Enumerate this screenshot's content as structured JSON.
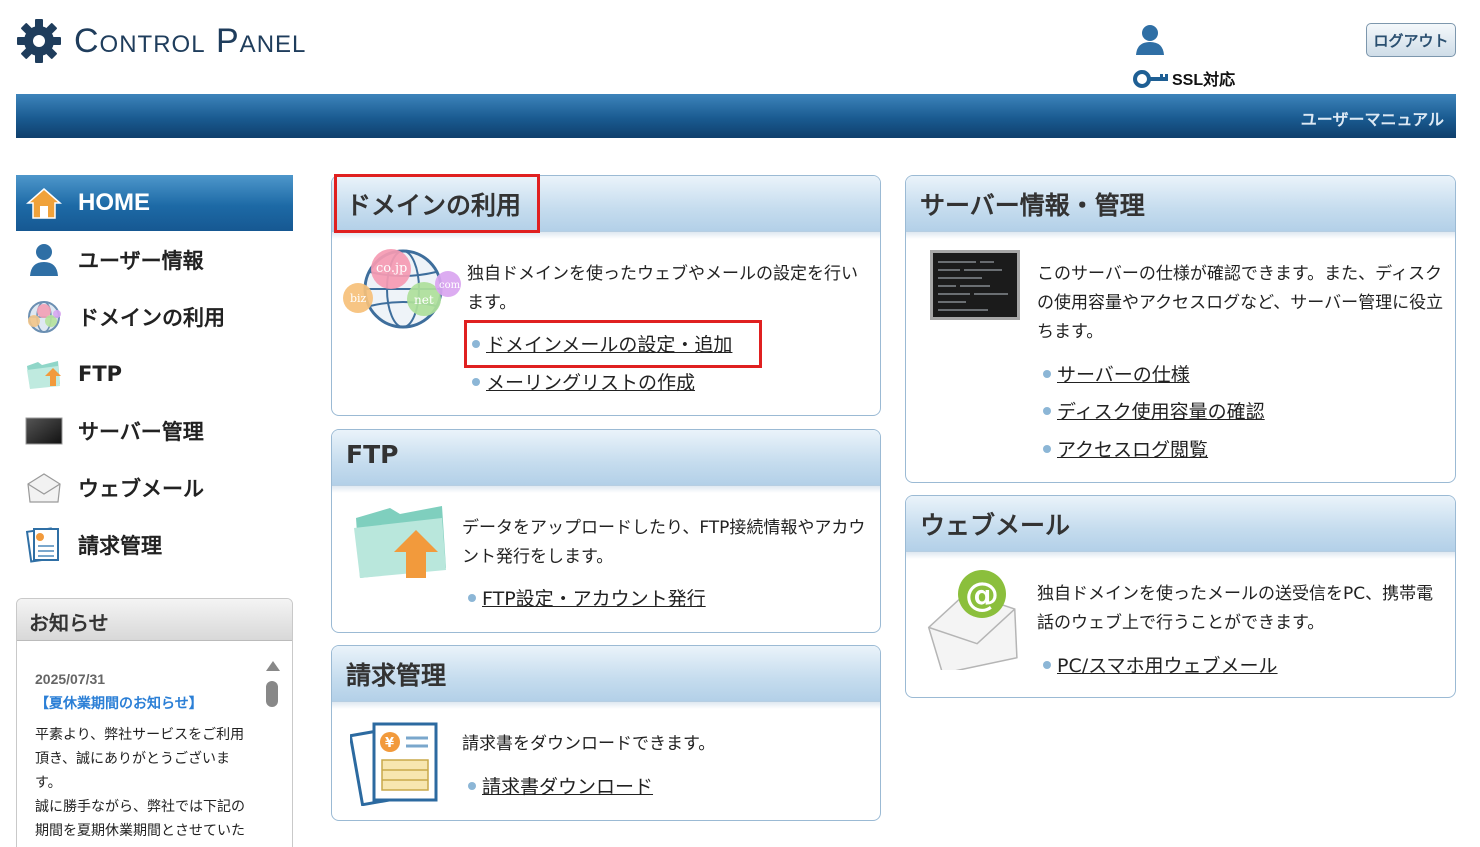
{
  "header": {
    "logo_text": "Control Panel",
    "ssl_label": "SSL対応",
    "logout_label": "ログアウト",
    "manual_label": "ユーザーマニュアル"
  },
  "sidebar": {
    "home_label": "HOME",
    "items": [
      {
        "label": "ユーザー情報",
        "icon": "user-icon"
      },
      {
        "label": "ドメインの利用",
        "icon": "globe-icon"
      },
      {
        "label": "FTP",
        "icon": "folder-upload-icon"
      },
      {
        "label": "サーバー管理",
        "icon": "monitor-icon"
      },
      {
        "label": "ウェブメール",
        "icon": "envelope-icon"
      },
      {
        "label": "請求管理",
        "icon": "invoice-icon"
      }
    ]
  },
  "notice": {
    "heading": "お知らせ",
    "date": "2025/07/31",
    "title": "【夏休業期間のお知らせ】",
    "text_lines": [
      "平素より、弊社サービスをご利用",
      "頂き、誠にありがとうございま",
      "す。",
      "誠に勝手ながら、弊社では下記の",
      "期間を夏期休業期間とさせていた"
    ]
  },
  "panels": {
    "domain": {
      "title": "ドメインの利用",
      "desc": "独自ドメインを使ったウェブやメールの設定を行います。",
      "links": [
        "ドメインメールの設定・追加",
        "メーリングリストの作成"
      ],
      "globe_labels": [
        "biz",
        "co.jp",
        "net",
        "com"
      ]
    },
    "ftp": {
      "title": "FTP",
      "desc": "データをアップロードしたり、FTP接続情報やアカウント発行をします。",
      "links": [
        "FTP設定・アカウント発行"
      ]
    },
    "billing": {
      "title": "請求管理",
      "desc": "請求書をダウンロードできます。",
      "links": [
        "請求書ダウンロード"
      ],
      "invoice_symbol": "¥"
    },
    "server": {
      "title": "サーバー情報・管理",
      "desc": "このサーバーの仕様が確認できます。また、ディスクの使用容量やアクセスログなど、サーバー管理に役立ちます。",
      "links": [
        "サーバーの仕様",
        "ディスク使用容量の確認",
        "アクセスログ閲覧"
      ]
    },
    "webmail": {
      "title": "ウェブメール",
      "desc": "独自ドメインを使ったメールの送受信をPC、携帯電話のウェブ上で行うことができます。",
      "links": [
        "PC/スマホ用ウェブメール"
      ],
      "mail_symbol": "@"
    }
  },
  "colors": {
    "accent_blue": "#1a5b91",
    "highlight_red": "#e02020",
    "notice_link": "#2b7fd6"
  }
}
